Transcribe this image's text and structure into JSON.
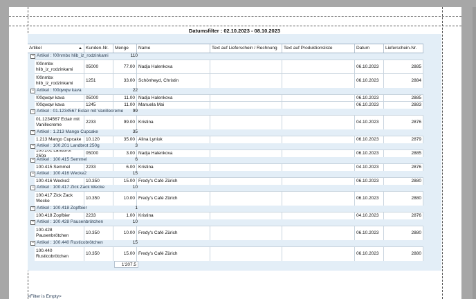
{
  "report": {
    "title": "Datumsfilter : 02.10.2023 - 08.10.2023",
    "filter_footer": "<Filter is Empty>"
  },
  "columns": [
    "Artikel",
    "Kunden-Nr.",
    "Menge",
    "Name",
    "Text auf Lieferschein / Rechnung",
    "Text auf Produktionsliste",
    "Datum",
    "Lieferschein-Nr."
  ],
  "groups": [
    {
      "label": "Artikel : !00nmbx hlib_iz_rodzinkami",
      "sum": "110",
      "rows": [
        {
          "artikel": "!00nmbx\nhlib_iz_rodzinkami",
          "kunde": "05000",
          "menge": "77.00",
          "name": "Nadja Halenkova",
          "datum": "06.10.2023",
          "ls": "2885"
        },
        {
          "artikel": "!00nmbx\nhlib_iz_rodzinkami",
          "kunde": "1251",
          "menge": "33.00",
          "name": "Schönheyd, Christin",
          "datum": "06.10.2023",
          "ls": "2884"
        }
      ]
    },
    {
      "label": "Artikel : !00qwqw kava",
      "sum": "22",
      "rows": [
        {
          "artikel": "!00qwqw kava",
          "kunde": "05000",
          "menge": "11.00",
          "name": "Nadja Halenkova",
          "datum": "06.10.2023",
          "ls": "2885"
        },
        {
          "artikel": "!00qwqw kava",
          "kunde": "1245",
          "menge": "11.00",
          "name": "Manuela Mai",
          "datum": "06.10.2023",
          "ls": "2883"
        }
      ]
    },
    {
      "label": "Artikel : 01.1234567 Eclair mit Vanillecreme",
      "sum": "99",
      "rows": [
        {
          "artikel": "01.1234567 Eclair mit\nVanillecreme",
          "kunde": "2233",
          "menge": "99.00",
          "name": "Kristina",
          "datum": "04.10.2023",
          "ls": "2876"
        }
      ]
    },
    {
      "label": "Artikel : 1.213 Mango Cupcake",
      "sum": "35",
      "rows": [
        {
          "artikel": "1.213 Mango Cupcake",
          "kunde": "10.120",
          "menge": "35.00",
          "name": "Alina Lyniuk",
          "datum": "06.10.2023",
          "ls": "2879"
        }
      ]
    },
    {
      "label": "Artikel : 100.201 Landbrot 250g",
      "sum": "3",
      "rows": [
        {
          "artikel": "100.201 Landbrot 250g",
          "kunde": "05000",
          "menge": "3.00",
          "name": "Nadja Halenkova",
          "datum": "06.10.2023",
          "ls": "2885"
        }
      ]
    },
    {
      "label": "Artikel : 100.415 Semmel",
      "sum": "6",
      "rows": [
        {
          "artikel": "100.415 Semmel",
          "kunde": "2233",
          "menge": "6.00",
          "name": "Kristina",
          "datum": "04.10.2023",
          "ls": "2876"
        }
      ]
    },
    {
      "label": "Artikel : 100.416 Wecke2",
      "sum": "15",
      "rows": [
        {
          "artikel": "100.416 Wecke2",
          "kunde": "10.350",
          "menge": "15.00",
          "name": "Fredy's Café Zürich",
          "datum": "06.10.2023",
          "ls": "2880"
        }
      ]
    },
    {
      "label": "Artikel : 100.417 Zick Zack Wecke",
      "sum": "10",
      "rows": [
        {
          "artikel": "100.417 Zick Zack\nWecke",
          "kunde": "10.350",
          "menge": "10.00",
          "name": "Fredy's Café Zürich",
          "datum": "06.10.2023",
          "ls": "2880"
        }
      ]
    },
    {
      "label": "Artikel : 100.418 Zopfbier",
      "sum": "1",
      "rows": [
        {
          "artikel": "100.418 Zopfbier",
          "kunde": "2233",
          "menge": "1.00",
          "name": "Kristina",
          "datum": "04.10.2023",
          "ls": "2876"
        }
      ]
    },
    {
      "label": "Artikel : 100.428 Pausenbrötchen",
      "sum": "10",
      "rows": [
        {
          "artikel": "100.428\nPausenbrötchen",
          "kunde": "10.350",
          "menge": "10.00",
          "name": "Fredy's Café Zürich",
          "datum": "06.10.2023",
          "ls": "2880"
        }
      ]
    },
    {
      "label": "Artikel : 100.440 Rusticobrötchen",
      "sum": "15",
      "rows": [
        {
          "artikel": "100.440\nRusticobrötchen",
          "kunde": "10.350",
          "menge": "15.00",
          "name": "Fredy's Café Zürich",
          "datum": "06.10.2023",
          "ls": "2880"
        }
      ]
    }
  ],
  "total": "1'207.5"
}
